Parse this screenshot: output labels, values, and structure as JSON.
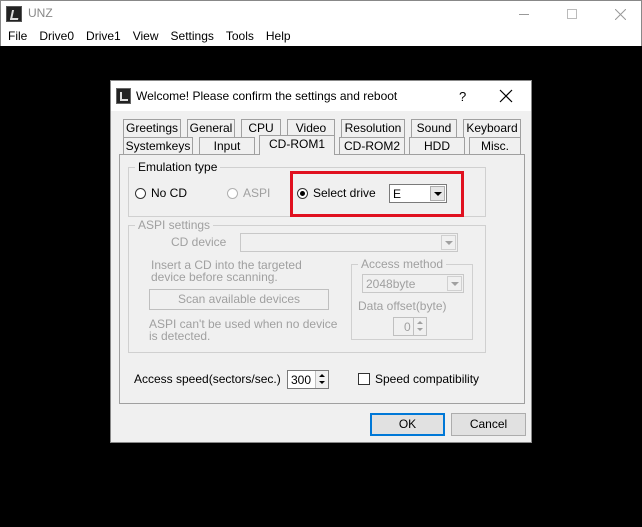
{
  "window": {
    "title": "UNZ",
    "menu": [
      "File",
      "Drive0",
      "Drive1",
      "View",
      "Settings",
      "Tools",
      "Help"
    ]
  },
  "dialog": {
    "title": "Welcome! Please confirm the settings and reboot",
    "help_label": "?",
    "tabs_row1": [
      "Greetings",
      "General",
      "CPU",
      "Video",
      "Resolution",
      "Sound",
      "Keyboard"
    ],
    "tabs_row2": [
      "Systemkeys",
      "Input",
      "CD-ROM1",
      "CD-ROM2",
      "HDD",
      "Misc."
    ],
    "active_tab": "CD-ROM1",
    "emulation": {
      "legend": "Emulation type",
      "options": [
        "No CD",
        "ASPI",
        "Select drive"
      ],
      "selected": "Select drive",
      "drive_value": "E"
    },
    "aspi": {
      "legend": "ASPI settings",
      "cd_device_label": "CD device",
      "cd_device_value": "",
      "insert_text_1": "Insert a CD into the targeted",
      "insert_text_2": "device before scanning.",
      "scan_button": "Scan available devices",
      "cant_text_1": "ASPI can't be used when no device",
      "cant_text_2": "is detected.",
      "access_method_legend": "Access method",
      "access_method_value": "2048byte",
      "data_offset_label": "Data offset(byte)",
      "data_offset_value": "0"
    },
    "access_speed_label": "Access speed(sectors/sec.)",
    "access_speed_value": "300",
    "speed_compat_label": "Speed compatibility",
    "speed_compat_checked": false,
    "ok_label": "OK",
    "cancel_label": "Cancel"
  },
  "colors": {
    "highlight": "#e0101f",
    "canvas": "#000000",
    "dialog_bg": "#f0f0f0",
    "default_button_border": "#0078d7"
  }
}
